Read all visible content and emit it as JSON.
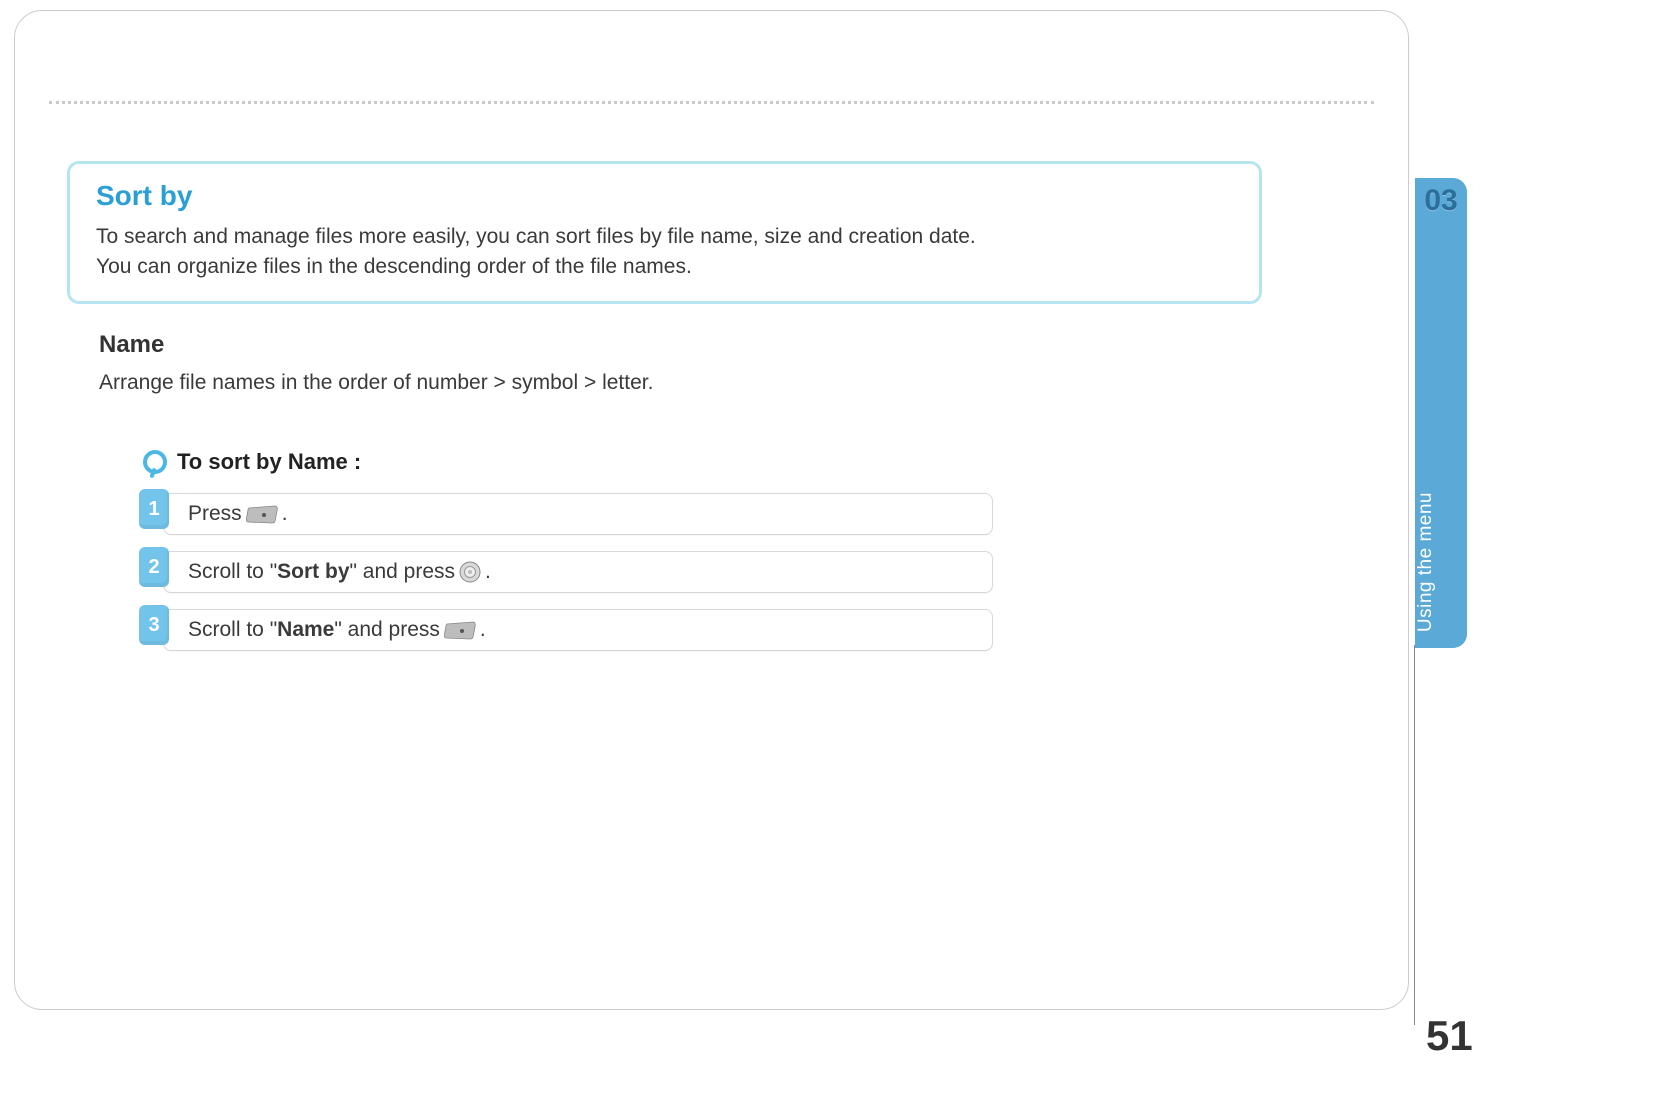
{
  "info": {
    "title": "Sort by",
    "desc_line1": "To search and manage files more easily, you can sort files by file name, size and creation date.",
    "desc_line2": "You can organize files in the descending order of the file names."
  },
  "section": {
    "heading": "Name",
    "desc": "Arrange file names in the order of number > symbol > letter."
  },
  "steps": {
    "title": "To sort by Name :",
    "items": [
      {
        "num": "1",
        "pre": "Press ",
        "bold": "",
        "post": ".",
        "icon": "menu-button"
      },
      {
        "num": "2",
        "pre": "Scroll to \"",
        "bold": "Sort by",
        "mid": "\" and press ",
        "post": ".",
        "icon": "ok-round"
      },
      {
        "num": "3",
        "pre": "Scroll to \"",
        "bold": "Name",
        "mid": "\" and press ",
        "post": ".",
        "icon": "menu-button"
      }
    ]
  },
  "side": {
    "chapter": "03",
    "label": "Using the menu"
  },
  "page_number": "51"
}
